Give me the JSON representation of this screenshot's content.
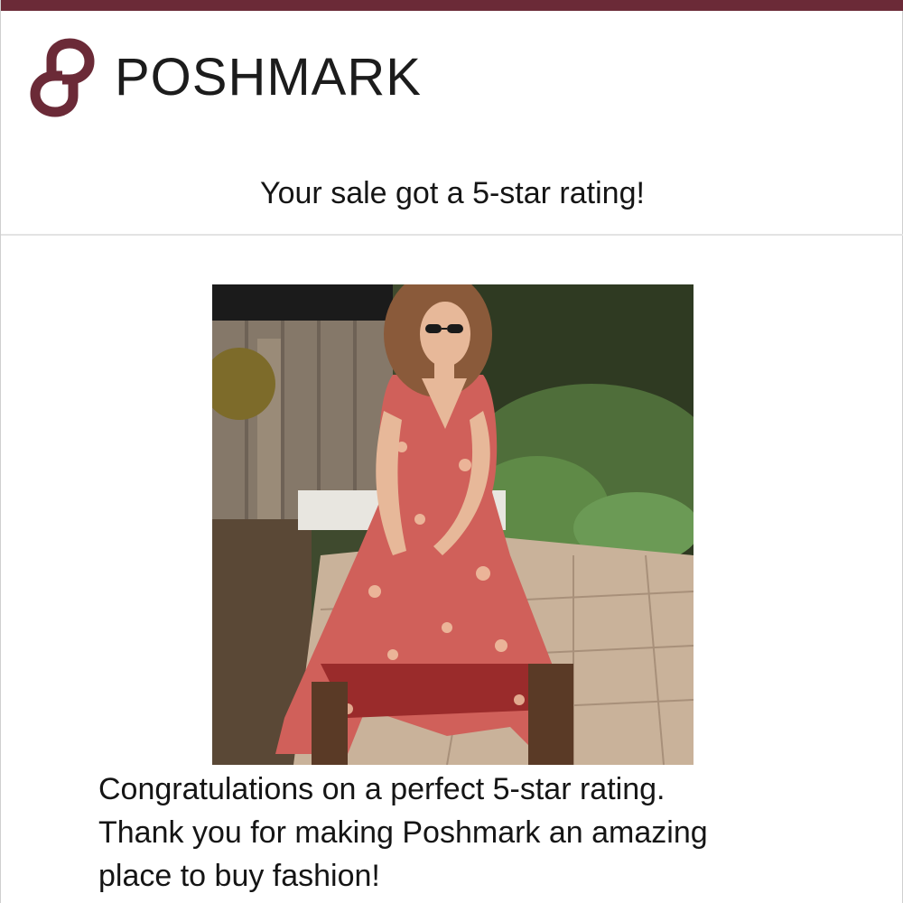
{
  "brand": {
    "name": "POSHMARK",
    "accent_color": "#6b2a37",
    "logo_icon": "poshmark-logo-icon"
  },
  "email": {
    "headline": "Your sale got a 5-star rating!",
    "message_lines": [
      "Congratulations on a perfect 5-star rating.",
      "Thank you for making Poshmark an amazing",
      "place to buy fashion!"
    ]
  },
  "product": {
    "image_icon": "product-photo",
    "description": "woman-in-floral-maxi-dress"
  }
}
